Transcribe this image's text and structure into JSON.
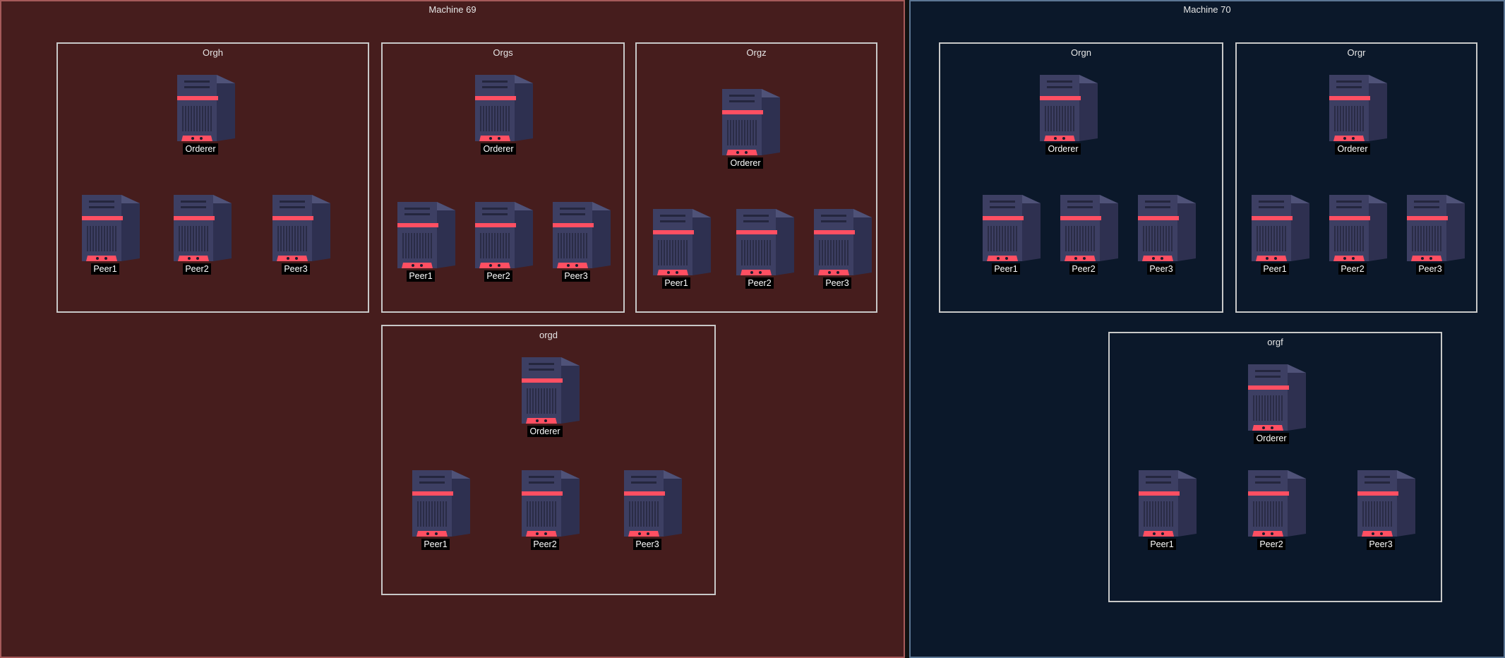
{
  "colors": {
    "machine_69_fill": "#461d1d",
    "machine_69_border": "#a55a5a",
    "machine_70_fill": "#0b182a",
    "machine_70_border": "#5c7694",
    "org_border": "#c8c8c8",
    "server_body": "#3d3f63",
    "server_accent": "#ff4f62"
  },
  "machines": [
    {
      "title": "Machine 69",
      "orgs": [
        {
          "title": "Orgh",
          "orderer": "Orderer",
          "peers": [
            "Peer1",
            "Peer2",
            "Peer3"
          ]
        },
        {
          "title": "Orgs",
          "orderer": "Orderer",
          "peers": [
            "Peer1",
            "Peer2",
            "Peer3"
          ]
        },
        {
          "title": "Orgz",
          "orderer": "Orderer",
          "peers": [
            "Peer1",
            "Peer2",
            "Peer3"
          ]
        },
        {
          "title": "orgd",
          "orderer": "Orderer",
          "peers": [
            "Peer1",
            "Peer2",
            "Peer3"
          ]
        }
      ]
    },
    {
      "title": "Machine 70",
      "orgs": [
        {
          "title": "Orgn",
          "orderer": "Orderer",
          "peers": [
            "Peer1",
            "Peer2",
            "Peer3"
          ]
        },
        {
          "title": "Orgr",
          "orderer": "Orderer",
          "peers": [
            "Peer1",
            "Peer2",
            "Peer3"
          ]
        },
        {
          "title": "orgf",
          "orderer": "Orderer",
          "peers": [
            "Peer1",
            "Peer2",
            "Peer3"
          ]
        }
      ]
    }
  ]
}
